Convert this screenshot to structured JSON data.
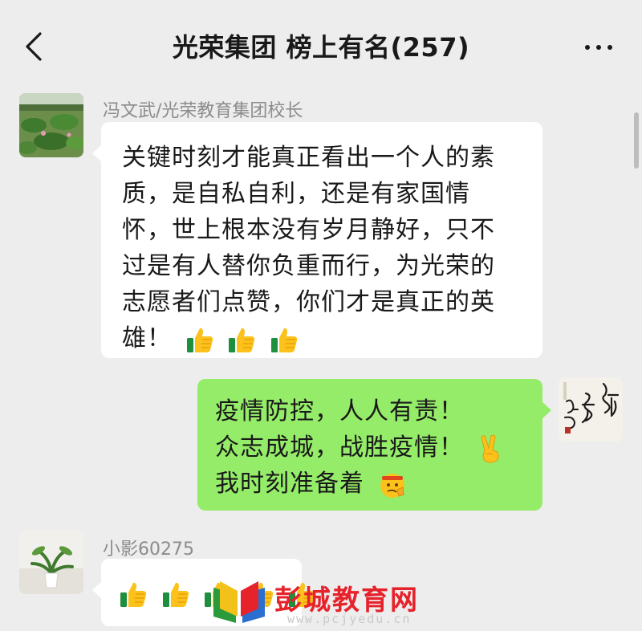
{
  "header": {
    "title": "光荣集团  榜上有名(257)",
    "back_icon": "chevron-left-icon",
    "more_icon": "more-dots-icon"
  },
  "messages": [
    {
      "sender": "冯文武/光荣教育集团校长",
      "direction": "incoming",
      "avatar": "lotus-pond-avatar",
      "lines": [
        "关键时刻才能真正看出一个人的素",
        "质，是自私自利，还是有家国情",
        "怀，世上根本没有岁月静好，只不",
        "过是有人替你负重而行，为光荣的",
        "志愿者们点赞，你们才是真正的英",
        "雄！"
      ],
      "emojis": [
        "thumbs-up-icon",
        "thumbs-up-icon",
        "thumbs-up-icon"
      ]
    },
    {
      "direction": "outgoing",
      "avatar": "calligraphy-avatar",
      "lines": [
        "疫情防控，人人有责！",
        "众志成城，战胜疫情！",
        "我时刻准备着"
      ],
      "emojis": [
        "victory-hand-icon",
        "saluting-face-icon"
      ]
    },
    {
      "sender": "小影60275",
      "direction": "incoming",
      "avatar": "plant-vase-avatar",
      "emojis": [
        "thumbs-up-icon",
        "thumbs-up-icon",
        "thumbs-up-icon",
        "thumbs-up-icon",
        "thumbs-up-icon"
      ]
    }
  ],
  "watermark": {
    "name": "彭城教育网",
    "url": "www.pcjyedu.cn"
  },
  "colors": {
    "background": "#ededed",
    "incoming_bubble": "#ffffff",
    "outgoing_bubble": "#95ec69",
    "sender_name": "#8c8c8c",
    "watermark": "#e6222b"
  }
}
